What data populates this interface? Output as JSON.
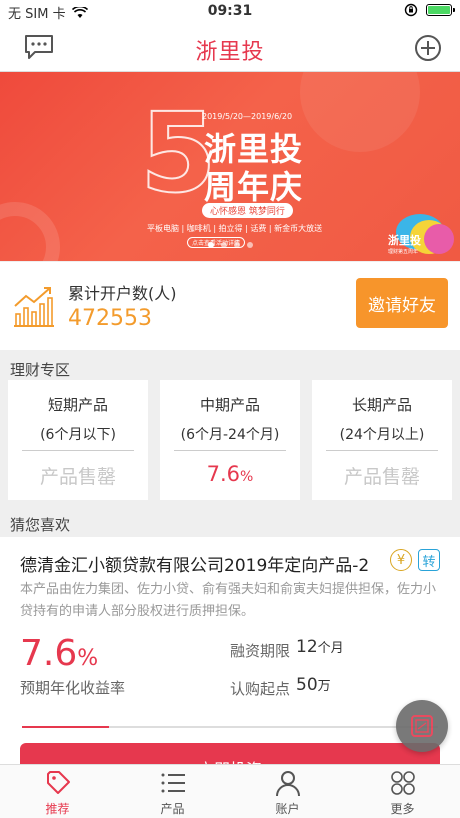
{
  "status_bar": {
    "carrier": "无 SIM 卡",
    "time": "09:31"
  },
  "header": {
    "title": "浙里投",
    "left_icon": "message-icon",
    "right_icon": "add-circle-icon"
  },
  "banner": {
    "big_number": "5",
    "dates": "2019/5/20—2019/6/20",
    "headline_1": "浙里投",
    "headline_2": "周年庆",
    "slogan": "心怀感恩 筑梦同行",
    "prizes": "平板电脑 | 咖啡机 | 拍立得 | 话费 | 新金币大放送",
    "cta": "点击查看活动详情",
    "brand": "浙里投",
    "brand_sub": "理财第五周年",
    "pager": {
      "count": 4,
      "active": 0
    }
  },
  "stats": {
    "label": "累计开户数(人)",
    "value": "472553",
    "invite_button": "邀请好友"
  },
  "finance_section": {
    "title": "理财专区",
    "products": [
      {
        "name": "短期产品",
        "period": "(6个月以下)",
        "status": "产品售罄",
        "hot": false
      },
      {
        "name": "中期产品",
        "period": "(6个月-24个月)",
        "status": "7.6%",
        "hot": true
      },
      {
        "name": "长期产品",
        "period": "(24个月以上)",
        "status": "产品售罄",
        "hot": false
      }
    ]
  },
  "recommend_section": {
    "title": "猜您喜欢",
    "card": {
      "title": "德清金汇小额贷款有限公司2019年定向产品-2",
      "badge_1": "¥",
      "badge_2": "转",
      "description": "本产品由佐力集团、佐力小贷、俞有强夫妇和俞寅夫妇提供担保，佐力小贷持有的申请人部分股权进行质押担保。",
      "rate": "7.6",
      "rate_unit": "%",
      "rate_label": "预期年化收益率",
      "term_label": "融资期限",
      "term_value": "12",
      "term_unit": "个月",
      "min_label": "认购起点",
      "min_value": "50",
      "min_unit": "万",
      "progress": 0.21,
      "invest_button": "立即投资"
    }
  },
  "tabbar": [
    {
      "label": "推荐",
      "icon": "recommend-tag-icon",
      "active": true
    },
    {
      "label": "产品",
      "icon": "list-icon",
      "active": false
    },
    {
      "label": "账户",
      "icon": "user-icon",
      "active": false
    },
    {
      "label": "更多",
      "icon": "grid-dots-icon",
      "active": false
    }
  ],
  "colors": {
    "brand_red": "#e6384e",
    "orange": "#f7952b"
  }
}
